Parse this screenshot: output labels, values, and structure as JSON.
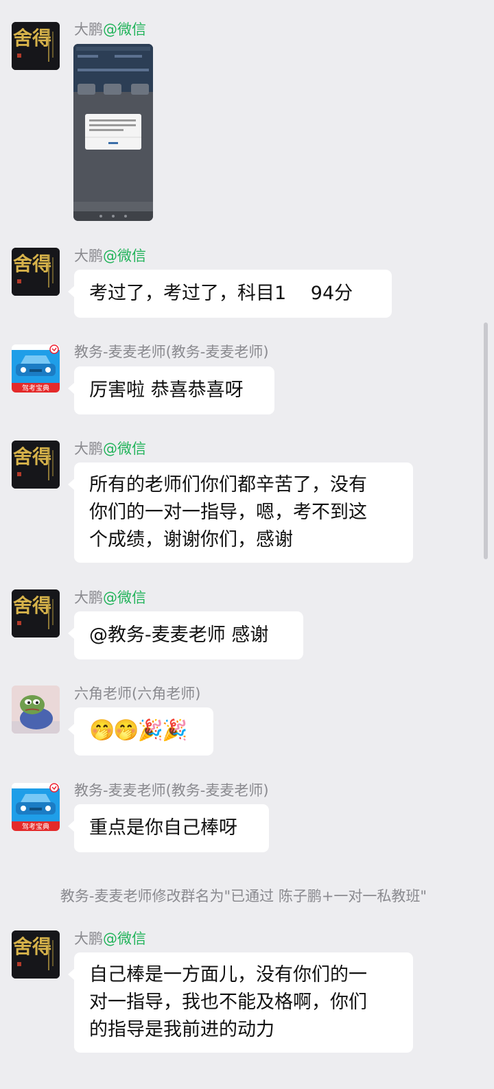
{
  "messages": [
    {
      "id": "m1",
      "sender_name": "大鹏",
      "sender_tag": "@微信",
      "type": "image"
    },
    {
      "id": "m2",
      "sender_name": "大鹏",
      "sender_tag": "@微信",
      "text": "考过了，考过了，科目1　 94分"
    },
    {
      "id": "m3",
      "sender_name": "教务-麦麦老师(教务-麦麦老师)",
      "sender_tag": "",
      "text": "厉害啦 恭喜恭喜呀"
    },
    {
      "id": "m4",
      "sender_name": "大鹏",
      "sender_tag": "@微信",
      "lines": [
        "所有的老师们你们都辛苦了，没有",
        "你们的一对一指导，嗯，考不到这",
        "个成绩，谢谢你们，感谢"
      ]
    },
    {
      "id": "m5",
      "sender_name": "大鹏",
      "sender_tag": "@微信",
      "text": "@教务-麦麦老师 感谢"
    },
    {
      "id": "m6",
      "sender_name": "六角老师(六角老师)",
      "sender_tag": "",
      "emojis": [
        "🤭",
        "🤭",
        "🎉",
        "🎉"
      ]
    },
    {
      "id": "m7",
      "sender_name": "教务-麦麦老师(教务-麦麦老师)",
      "sender_tag": "",
      "text": "重点是你自己棒呀"
    },
    {
      "id": "m8",
      "sender_name": "大鹏",
      "sender_tag": "@微信",
      "lines": [
        "自己棒是一方面儿，没有你们的一",
        "对一指导，我也不能及格啊，你们",
        "的指导是我前进的动力"
      ]
    }
  ],
  "system_notice": "教务-麦麦老师修改群名为\"已通过 陈子鹏+一对一私教班\"",
  "avatars": {
    "shede_text": "舍得",
    "car_badge": "驾考宝典"
  },
  "colors": {
    "background": "#ededf0",
    "bubble": "#ffffff",
    "wechat_tag": "#21b35a",
    "sender": "#8a8a8f"
  }
}
